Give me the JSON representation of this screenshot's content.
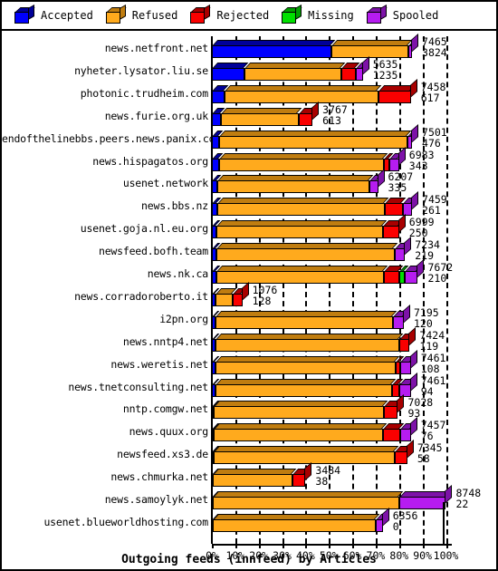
{
  "legend": {
    "items": [
      {
        "label": "Accepted",
        "color": "#0000ff",
        "dark": "#000099",
        "icon": "cube-icon"
      },
      {
        "label": "Refused",
        "color": "#ffaa1d",
        "dark": "#c07d10",
        "icon": "cube-icon"
      },
      {
        "label": "Rejected",
        "color": "#fa0000",
        "dark": "#a80000",
        "icon": "cube-icon"
      },
      {
        "label": "Missing",
        "color": "#00e000",
        "dark": "#00a000",
        "icon": "cube-icon"
      },
      {
        "label": "Spooled",
        "color": "#b61cf0",
        "dark": "#7d12a8",
        "icon": "cube-icon"
      }
    ]
  },
  "chart_data": {
    "type": "bar",
    "orientation": "horizontal",
    "stacked": true,
    "percent_axis": true,
    "title": "Outgoing feeds (innfeed) by Articles",
    "xlabel": "",
    "ylabel": "",
    "xlim": [
      0,
      100
    ],
    "xticks": [
      "0%",
      "10%",
      "20%",
      "30%",
      "40%",
      "50%",
      "60%",
      "70%",
      "80%",
      "90%",
      "100%"
    ],
    "grid": true,
    "legend_position": "top",
    "series_names": [
      "Accepted",
      "Refused",
      "Rejected",
      "Missing",
      "Spooled"
    ],
    "categories": [
      "news.netfront.net",
      "nyheter.lysator.liu.se",
      "photonic.trudheim.com",
      "news.furie.org.uk",
      "endofthelinebbs.peers.news.panix.com",
      "news.hispagatos.org",
      "usenet.network",
      "news.bbs.nz",
      "usenet.goja.nl.eu.org",
      "newsfeed.bofh.team",
      "news.nk.ca",
      "news.corradoroberto.it",
      "i2pn.org",
      "news.nntp4.net",
      "news.weretis.net",
      "news.tnetconsulting.net",
      "nntp.comgw.net",
      "news.quux.org",
      "newsfeed.xs3.de",
      "news.chmurka.net",
      "news.samoylyk.net",
      "usenet.blueworldhosting.com"
    ],
    "value_labels": [
      {
        "top": "7465",
        "bottom": "3824"
      },
      {
        "top": "5635",
        "bottom": "1235"
      },
      {
        "top": "7458",
        "bottom": "617"
      },
      {
        "top": "3767",
        "bottom": "613"
      },
      {
        "top": "7501",
        "bottom": "476"
      },
      {
        "top": "6983",
        "bottom": "343"
      },
      {
        "top": "6207",
        "bottom": "335"
      },
      {
        "top": "7459",
        "bottom": "261"
      },
      {
        "top": "6999",
        "bottom": "250"
      },
      {
        "top": "7234",
        "bottom": "219"
      },
      {
        "top": "7672",
        "bottom": "210"
      },
      {
        "top": "1076",
        "bottom": "128"
      },
      {
        "top": "7195",
        "bottom": "120"
      },
      {
        "top": "7424",
        "bottom": "119"
      },
      {
        "top": "7461",
        "bottom": "108"
      },
      {
        "top": "7461",
        "bottom": "94"
      },
      {
        "top": "7028",
        "bottom": "93"
      },
      {
        "top": "7457",
        "bottom": "76"
      },
      {
        "top": "7345",
        "bottom": "58"
      },
      {
        "top": "3484",
        "bottom": "38"
      },
      {
        "top": "8748",
        "bottom": "22"
      },
      {
        "top": "6356",
        "bottom": "0"
      }
    ],
    "bars": [
      {
        "total_pct": 85.5,
        "segments": [
          {
            "s": "Accepted",
            "pct": 51.0
          },
          {
            "s": "Refused",
            "pct": 33.0
          },
          {
            "s": "Rejected",
            "pct": 0.0
          },
          {
            "s": "Missing",
            "pct": 0.0
          },
          {
            "s": "Spooled",
            "pct": 1.5
          }
        ]
      },
      {
        "total_pct": 64.5,
        "segments": [
          {
            "s": "Accepted",
            "pct": 14.0
          },
          {
            "s": "Refused",
            "pct": 41.5
          },
          {
            "s": "Rejected",
            "pct": 6.0
          },
          {
            "s": "Missing",
            "pct": 0.0
          },
          {
            "s": "Spooled",
            "pct": 3.0
          }
        ]
      },
      {
        "total_pct": 85.0,
        "segments": [
          {
            "s": "Accepted",
            "pct": 5.5
          },
          {
            "s": "Refused",
            "pct": 65.5
          },
          {
            "s": "Rejected",
            "pct": 14.0
          },
          {
            "s": "Missing",
            "pct": 0.0
          },
          {
            "s": "Spooled",
            "pct": 0.0
          }
        ]
      },
      {
        "total_pct": 43.0,
        "segments": [
          {
            "s": "Accepted",
            "pct": 4.0
          },
          {
            "s": "Refused",
            "pct": 33.0
          },
          {
            "s": "Rejected",
            "pct": 6.0
          },
          {
            "s": "Missing",
            "pct": 0.0
          },
          {
            "s": "Spooled",
            "pct": 0.0
          }
        ]
      },
      {
        "total_pct": 85.5,
        "segments": [
          {
            "s": "Accepted",
            "pct": 3.0
          },
          {
            "s": "Refused",
            "pct": 80.5
          },
          {
            "s": "Rejected",
            "pct": 0.0
          },
          {
            "s": "Missing",
            "pct": 0.0
          },
          {
            "s": "Spooled",
            "pct": 2.0
          }
        ]
      },
      {
        "total_pct": 80.0,
        "segments": [
          {
            "s": "Accepted",
            "pct": 3.0
          },
          {
            "s": "Refused",
            "pct": 70.5
          },
          {
            "s": "Rejected",
            "pct": 2.5
          },
          {
            "s": "Missing",
            "pct": 0.0
          },
          {
            "s": "Spooled",
            "pct": 4.0
          }
        ]
      },
      {
        "total_pct": 71.0,
        "segments": [
          {
            "s": "Accepted",
            "pct": 2.5
          },
          {
            "s": "Refused",
            "pct": 65.0
          },
          {
            "s": "Rejected",
            "pct": 0.0
          },
          {
            "s": "Missing",
            "pct": 0.0
          },
          {
            "s": "Spooled",
            "pct": 3.5
          }
        ]
      },
      {
        "total_pct": 85.5,
        "segments": [
          {
            "s": "Accepted",
            "pct": 2.5
          },
          {
            "s": "Refused",
            "pct": 71.5
          },
          {
            "s": "Rejected",
            "pct": 7.5
          },
          {
            "s": "Missing",
            "pct": 0.0
          },
          {
            "s": "Spooled",
            "pct": 4.0
          }
        ]
      },
      {
        "total_pct": 80.0,
        "segments": [
          {
            "s": "Accepted",
            "pct": 2.0
          },
          {
            "s": "Refused",
            "pct": 71.0
          },
          {
            "s": "Rejected",
            "pct": 7.0
          },
          {
            "s": "Missing",
            "pct": 0.0
          },
          {
            "s": "Spooled",
            "pct": 0.0
          }
        ]
      },
      {
        "total_pct": 82.5,
        "segments": [
          {
            "s": "Accepted",
            "pct": 2.0
          },
          {
            "s": "Refused",
            "pct": 76.0
          },
          {
            "s": "Rejected",
            "pct": 0.0
          },
          {
            "s": "Missing",
            "pct": 0.0
          },
          {
            "s": "Spooled",
            "pct": 4.5
          }
        ]
      },
      {
        "total_pct": 88.0,
        "segments": [
          {
            "s": "Accepted",
            "pct": 2.0
          },
          {
            "s": "Refused",
            "pct": 71.5
          },
          {
            "s": "Rejected",
            "pct": 6.5
          },
          {
            "s": "Missing",
            "pct": 2.5
          },
          {
            "s": "Spooled",
            "pct": 5.5
          }
        ]
      },
      {
        "total_pct": 13.0,
        "segments": [
          {
            "s": "Accepted",
            "pct": 1.5
          },
          {
            "s": "Refused",
            "pct": 7.5
          },
          {
            "s": "Rejected",
            "pct": 4.0
          },
          {
            "s": "Missing",
            "pct": 0.0
          },
          {
            "s": "Spooled",
            "pct": 0.0
          }
        ]
      },
      {
        "total_pct": 82.0,
        "segments": [
          {
            "s": "Accepted",
            "pct": 1.5
          },
          {
            "s": "Refused",
            "pct": 76.0
          },
          {
            "s": "Rejected",
            "pct": 0.0
          },
          {
            "s": "Missing",
            "pct": 0.0
          },
          {
            "s": "Spooled",
            "pct": 4.5
          }
        ]
      },
      {
        "total_pct": 84.5,
        "segments": [
          {
            "s": "Accepted",
            "pct": 1.5
          },
          {
            "s": "Refused",
            "pct": 78.5
          },
          {
            "s": "Rejected",
            "pct": 4.5
          },
          {
            "s": "Missing",
            "pct": 0.0
          },
          {
            "s": "Spooled",
            "pct": 0.0
          }
        ]
      },
      {
        "total_pct": 85.0,
        "segments": [
          {
            "s": "Accepted",
            "pct": 1.5
          },
          {
            "s": "Refused",
            "pct": 77.0
          },
          {
            "s": "Rejected",
            "pct": 2.0
          },
          {
            "s": "Missing",
            "pct": 0.0
          },
          {
            "s": "Spooled",
            "pct": 4.5
          }
        ]
      },
      {
        "total_pct": 85.0,
        "segments": [
          {
            "s": "Accepted",
            "pct": 1.5
          },
          {
            "s": "Refused",
            "pct": 75.5
          },
          {
            "s": "Rejected",
            "pct": 3.0
          },
          {
            "s": "Missing",
            "pct": 0.0
          },
          {
            "s": "Spooled",
            "pct": 5.0
          }
        ]
      },
      {
        "total_pct": 79.5,
        "segments": [
          {
            "s": "Accepted",
            "pct": 0.8
          },
          {
            "s": "Refused",
            "pct": 72.7
          },
          {
            "s": "Rejected",
            "pct": 6.0
          },
          {
            "s": "Missing",
            "pct": 0.0
          },
          {
            "s": "Spooled",
            "pct": 0.0
          }
        ]
      },
      {
        "total_pct": 85.0,
        "segments": [
          {
            "s": "Accepted",
            "pct": 0.8
          },
          {
            "s": "Refused",
            "pct": 72.2
          },
          {
            "s": "Rejected",
            "pct": 7.5
          },
          {
            "s": "Missing",
            "pct": 0.0
          },
          {
            "s": "Spooled",
            "pct": 4.5
          }
        ]
      },
      {
        "total_pct": 83.5,
        "segments": [
          {
            "s": "Accepted",
            "pct": 0.8
          },
          {
            "s": "Refused",
            "pct": 77.2
          },
          {
            "s": "Rejected",
            "pct": 5.5
          },
          {
            "s": "Missing",
            "pct": 0.0
          },
          {
            "s": "Spooled",
            "pct": 0.0
          }
        ]
      },
      {
        "total_pct": 40.0,
        "segments": [
          {
            "s": "Accepted",
            "pct": 0.5
          },
          {
            "s": "Refused",
            "pct": 34.0
          },
          {
            "s": "Rejected",
            "pct": 5.5
          },
          {
            "s": "Missing",
            "pct": 0.0
          },
          {
            "s": "Spooled",
            "pct": 0.0
          }
        ]
      },
      {
        "total_pct": 100.0,
        "segments": [
          {
            "s": "Accepted",
            "pct": 0.5
          },
          {
            "s": "Refused",
            "pct": 79.5
          },
          {
            "s": "Rejected",
            "pct": 0.0
          },
          {
            "s": "Missing",
            "pct": 0.0
          },
          {
            "s": "Spooled",
            "pct": 20.0
          }
        ]
      },
      {
        "total_pct": 73.0,
        "segments": [
          {
            "s": "Accepted",
            "pct": 0.3
          },
          {
            "s": "Refused",
            "pct": 69.7
          },
          {
            "s": "Rejected",
            "pct": 0.0
          },
          {
            "s": "Missing",
            "pct": 0.0
          },
          {
            "s": "Spooled",
            "pct": 3.0
          }
        ]
      }
    ]
  }
}
